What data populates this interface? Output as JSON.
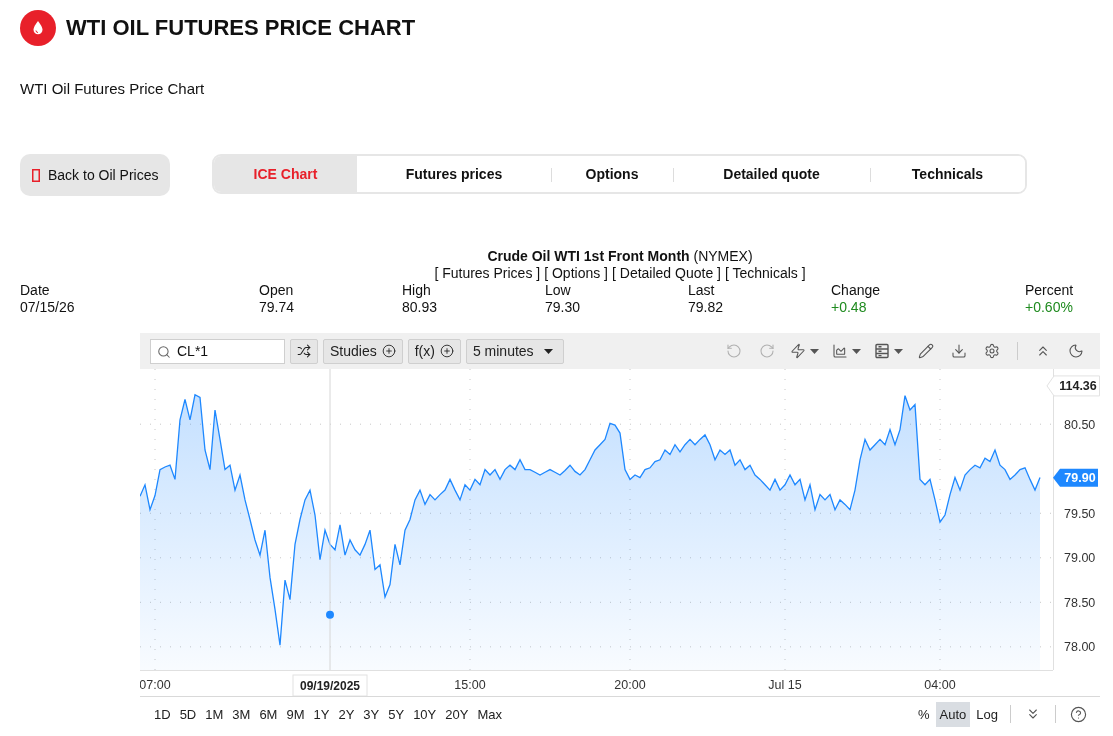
{
  "header": {
    "title": "WTI OIL FUTURES PRICE CHART",
    "subtitle": "WTI Oil Futures Price Chart"
  },
  "back_button": {
    "label": "Back to Oil Prices"
  },
  "tabs": [
    {
      "label": "ICE Chart",
      "selected": true
    },
    {
      "label": "Futures prices",
      "selected": false
    },
    {
      "label": "Options",
      "selected": false
    },
    {
      "label": "Detailed quote",
      "selected": false
    },
    {
      "label": "Technicals",
      "selected": false
    }
  ],
  "quote": {
    "title": "**Crude Oil WTI 1st Front Month** (NYMEX)",
    "links": [
      "[ Futures Prices ]",
      "[ Options ]",
      "[ Detailed Quote ]",
      "[ Technicals ]"
    ],
    "stats": [
      {
        "label": "Date",
        "value": "07/15/26"
      },
      {
        "label": "Open",
        "value": "79.74"
      },
      {
        "label": "High",
        "value": "80.93"
      },
      {
        "label": "Low",
        "value": "79.30"
      },
      {
        "label": "Last",
        "value": "79.82"
      },
      {
        "label": "Change",
        "value": "+0.48",
        "color": "#1e8a1e"
      },
      {
        "label": "Percent",
        "value": "+0.60%",
        "color": "#1e8a1e"
      }
    ]
  },
  "chart_widget": {
    "toolbar": {
      "symbol_field": {
        "value": "CL*1"
      },
      "buttons": [
        {
          "label": "Studies"
        },
        {
          "label": "f(x)"
        }
      ],
      "interval_dropdown": {
        "value": "5 minutes"
      },
      "history_buttons": [
        {
          "kind": "undo",
          "disabled": true
        },
        {
          "kind": "redo",
          "disabled": true
        }
      ]
    },
    "chart": {
      "crosshair": {
        "label": "09/19/2025"
      },
      "value_tag": {
        "label": "114.36"
      },
      "price_tag": {
        "label": "79.90"
      },
      "chart_data": {
        "type": "area",
        "grid": true,
        "categories": [
          null,
          null,
          null,
          "07:00",
          null,
          null,
          null,
          null,
          null,
          null,
          null,
          null,
          null,
          null,
          null,
          null,
          null,
          null,
          null,
          null,
          null,
          null,
          null,
          null,
          null,
          null,
          null,
          null,
          null,
          null,
          null,
          null,
          null,
          null,
          null,
          null,
          null,
          null,
          null,
          null,
          null,
          null,
          null,
          null,
          null,
          null,
          null,
          null,
          null,
          null,
          null,
          null,
          null,
          null,
          null,
          null,
          null,
          null,
          null,
          null,
          null,
          null,
          null,
          null,
          null,
          null,
          "15:00",
          null,
          null,
          null,
          null,
          null,
          null,
          null,
          null,
          null,
          null,
          null,
          null,
          null,
          null,
          null,
          null,
          null,
          null,
          null,
          null,
          null,
          null,
          null,
          null,
          null,
          null,
          null,
          null,
          null,
          null,
          null,
          "20:00",
          null,
          null,
          null,
          null,
          null,
          null,
          null,
          null,
          null,
          null,
          null,
          null,
          null,
          null,
          null,
          null,
          null,
          null,
          null,
          null,
          null,
          null,
          null,
          null,
          null,
          null,
          null,
          null,
          null,
          null,
          "Jul 15",
          null,
          null,
          null,
          null,
          null,
          null,
          null,
          null,
          null,
          null,
          null,
          null,
          null,
          null,
          null,
          null,
          null,
          null,
          null,
          null,
          null,
          null,
          null,
          null,
          null,
          null,
          null,
          null,
          null,
          null,
          "04:00",
          null,
          null,
          null,
          null,
          null,
          null,
          null,
          null,
          null,
          null,
          null,
          null,
          null,
          null,
          null,
          null,
          null,
          null,
          null,
          null
        ],
        "series": [
          {
            "color": "#1e88ff",
            "values": [
              79.69,
              79.82,
              79.54,
              79.7,
              79.99,
              80.02,
              80.04,
              79.88,
              80.55,
              80.78,
              80.55,
              80.83,
              80.8,
              80.21,
              79.99,
              80.66,
              80.33,
              79.99,
              80.04,
              79.76,
              79.93,
              79.65,
              79.43,
              79.2,
              79.03,
              79.31,
              78.78,
              78.42,
              78.02,
              78.75,
              78.53,
              79.15,
              79.43,
              79.65,
              79.76,
              79.48,
              78.98,
              79.31,
              79.15,
              79.09,
              79.37,
              79.03,
              79.2,
              79.09,
              79.03,
              79.15,
              79.31,
              78.87,
              78.92,
              78.56,
              78.7,
              79.15,
              78.92,
              79.31,
              79.43,
              79.65,
              79.76,
              79.6,
              79.71,
              79.65,
              79.71,
              79.76,
              79.88,
              79.76,
              79.65,
              79.82,
              79.76,
              79.88,
              79.82,
              79.99,
              79.93,
              79.99,
              79.88,
              79.99,
              80.04,
              79.99,
              80.1,
              79.99,
              79.99,
              79.96,
              79.93,
              79.96,
              79.99,
              79.96,
              79.93,
              79.98,
              80.04,
              79.97,
              79.93,
              79.99,
              80.1,
              80.21,
              80.27,
              80.33,
              80.51,
              80.49,
              80.4,
              79.99,
              79.88,
              79.93,
              79.9,
              79.99,
              80.01,
              80.08,
              80.1,
              80.21,
              80.16,
              80.27,
              80.19,
              80.27,
              80.33,
              80.27,
              80.33,
              80.38,
              80.27,
              80.1,
              80.21,
              80.16,
              80.21,
              80.04,
              80.1,
              79.99,
              80.04,
              79.93,
              79.88,
              79.82,
              79.76,
              79.88,
              79.76,
              79.82,
              79.93,
              79.82,
              79.88,
              79.65,
              79.82,
              79.54,
              79.71,
              79.65,
              79.71,
              79.54,
              79.65,
              79.6,
              79.54,
              79.76,
              80.1,
              80.33,
              80.21,
              80.27,
              80.33,
              80.27,
              80.44,
              80.27,
              80.44,
              80.82,
              80.66,
              80.72,
              79.88,
              79.82,
              79.88,
              79.65,
              79.4,
              79.48,
              79.71,
              79.9,
              79.76,
              79.93,
              79.99,
              80.04,
              80.01,
              80.12,
              80.08,
              80.21,
              80.04,
              79.99,
              79.88,
              79.93,
              79.99,
              80.01,
              79.88,
              79.76,
              79.9
            ]
          }
        ],
        "ylim": [
          77.74,
          81.12
        ],
        "yticks": [
          {
            "value": 78,
            "label": "78.00"
          },
          {
            "value": 78.5,
            "label": "78.50"
          },
          {
            "value": 79,
            "label": "79.00"
          },
          {
            "value": 79.5,
            "label": "79.50"
          },
          {
            "value": 80.5,
            "label": "80.50"
          }
        ]
      }
    },
    "bottom_bar": {
      "ranges": [
        {
          "label": "1D",
          "selected": false
        },
        {
          "label": "5D",
          "selected": false
        },
        {
          "label": "1M",
          "selected": false
        },
        {
          "label": "3M",
          "selected": false
        },
        {
          "label": "6M",
          "selected": false
        },
        {
          "label": "9M",
          "selected": false
        },
        {
          "label": "1Y",
          "selected": false
        },
        {
          "label": "2Y",
          "selected": false
        },
        {
          "label": "3Y",
          "selected": false
        },
        {
          "label": "5Y",
          "selected": false
        },
        {
          "label": "10Y",
          "selected": false
        },
        {
          "label": "20Y",
          "selected": false
        },
        {
          "label": "Max",
          "selected": false
        }
      ],
      "scales": [
        {
          "label": "%",
          "selected": false
        },
        {
          "label": "Auto",
          "selected": true
        },
        {
          "label": "Log",
          "selected": false
        }
      ]
    }
  }
}
